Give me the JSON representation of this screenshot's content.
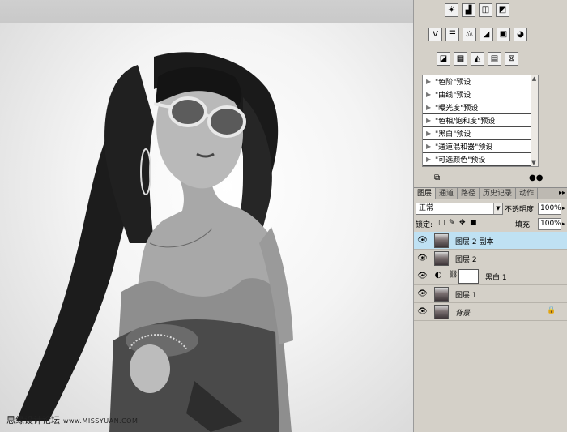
{
  "watermark": {
    "text": "思缘设计论坛",
    "url": "www.MISSYUAN.COM"
  },
  "adjustments": {
    "row1_icons": [
      "brightness-contrast-icon",
      "levels-icon",
      "curves-icon",
      "exposure-icon"
    ],
    "row2_icons": [
      "vibrance-icon",
      "hue-saturation-icon",
      "color-balance-icon",
      "black-white-icon",
      "photo-filter-icon",
      "channel-mixer-icon"
    ],
    "row3_icons": [
      "invert-icon",
      "posterize-icon",
      "threshold-icon",
      "gradient-map-icon",
      "selective-color-icon"
    ],
    "row1_glyphs": [
      "☀",
      "▟",
      "◫",
      "◩"
    ],
    "row2_glyphs": [
      "V",
      "☰",
      "⚖",
      "◢",
      "▣",
      "◕"
    ],
    "row3_glyphs": [
      "◪",
      "▦",
      "◭",
      "▤",
      "⊠"
    ],
    "presets": [
      "\"色阶\"预设",
      "\"曲线\"预设",
      "\"曝光度\"预设",
      "\"色相/饱和度\"预设",
      "\"黑白\"预设",
      "\"通道混和器\"预设",
      "\"可选颜色\"预设"
    ],
    "footer_left_glyph": "⧉",
    "footer_right_glyph": "●●"
  },
  "tabs": [
    "图层",
    "通道",
    "路径",
    "历史记录",
    "动作"
  ],
  "tabs_more": "▸▸",
  "blend_mode": "正常",
  "opacity_label": "不透明度:",
  "opacity_value": "100%",
  "lock_label": "锁定:",
  "fill_label": "填充:",
  "fill_value": "100%",
  "layers": [
    {
      "name": "图层 2 副本",
      "selected": true
    },
    {
      "name": "图层 2",
      "selected": false
    },
    {
      "name": "黑白 1",
      "selected": false,
      "adjustment": true
    },
    {
      "name": "图层 1",
      "selected": false
    },
    {
      "name": "背景",
      "selected": false,
      "locked": true
    }
  ]
}
